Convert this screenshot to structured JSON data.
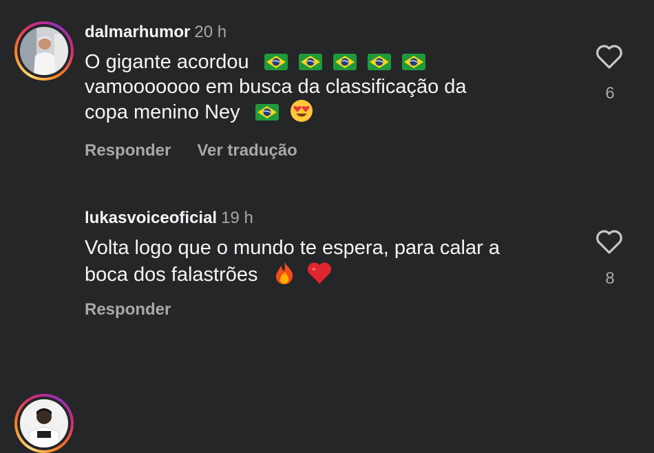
{
  "comments": [
    {
      "username": "dalmarhumor",
      "time": "20 h",
      "line1": "O gigante acordou",
      "line2": "vamooooooo em busca da classificação da",
      "line3": "copa menino Ney",
      "reply_label": "Responder",
      "translate_label": "Ver tradução",
      "likes": "6",
      "icons": [
        "brazil-flag",
        "brazil-flag",
        "brazil-flag",
        "brazil-flag",
        "brazil-flag",
        "brazil-flag",
        "heart-eyes-emoji"
      ]
    },
    {
      "username": "lukasvoiceoficial",
      "time": "19 h",
      "line1": "Volta logo que o mundo te espera, para calar a",
      "line2": "boca dos falastrões",
      "reply_label": "Responder",
      "likes": "8",
      "icons": [
        "fire-emoji",
        "red-heart-emoji"
      ]
    }
  ],
  "colors": {
    "background": "#252628",
    "text": "#f3f5f7",
    "muted": "#a8a8a8",
    "flag_green": "#1f9a3b",
    "flag_yellow": "#f9d616",
    "flag_blue": "#1f3d8a"
  }
}
